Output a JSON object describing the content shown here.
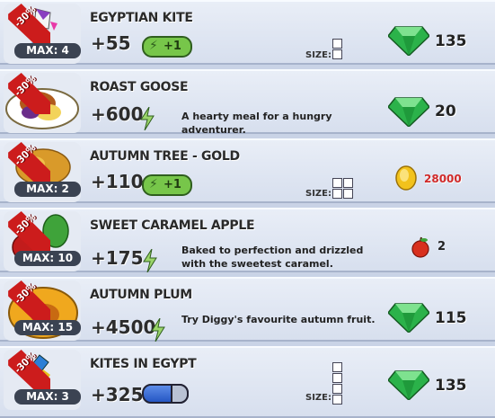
{
  "sale_badge": "-30%",
  "size_label": "SIZE:",
  "colors": {
    "gem": "#2bb24a",
    "energy": "#77c64a",
    "sale": "#cc1c1c",
    "coin_price": "#d02a2a"
  },
  "items": [
    {
      "name": "EGYPTIAN KITE",
      "max": "MAX: 4",
      "amount": "+55",
      "energy_badge": "+1",
      "price": "135",
      "currency": "gem-icon",
      "size": "1x2"
    },
    {
      "name": "ROAST GOOSE",
      "max": "",
      "amount": "+600",
      "description": "A hearty meal for a hungry adventurer.",
      "price": "20",
      "currency": "gem-icon"
    },
    {
      "name": "AUTUMN TREE - GOLD",
      "max": "MAX: 2",
      "amount": "+110",
      "energy_badge": "+1",
      "price": "28000",
      "currency": "coin-icon",
      "size": "2x2"
    },
    {
      "name": "SWEET CARAMEL APPLE",
      "max": "MAX: 10",
      "amount": "+175",
      "description": "Baked to perfection and drizzled with the sweetest caramel.",
      "price": "2",
      "currency": "apple-icon"
    },
    {
      "name": "AUTUMN PLUM",
      "max": "MAX: 15",
      "amount": "+4500",
      "description": "Try Diggy's favourite autumn fruit.",
      "price": "115",
      "currency": "gem-icon"
    },
    {
      "name": "KITES IN EGYPT",
      "max": "MAX: 3",
      "amount": "+325",
      "price": "135",
      "currency": "gem-icon",
      "size": "1x4"
    }
  ]
}
